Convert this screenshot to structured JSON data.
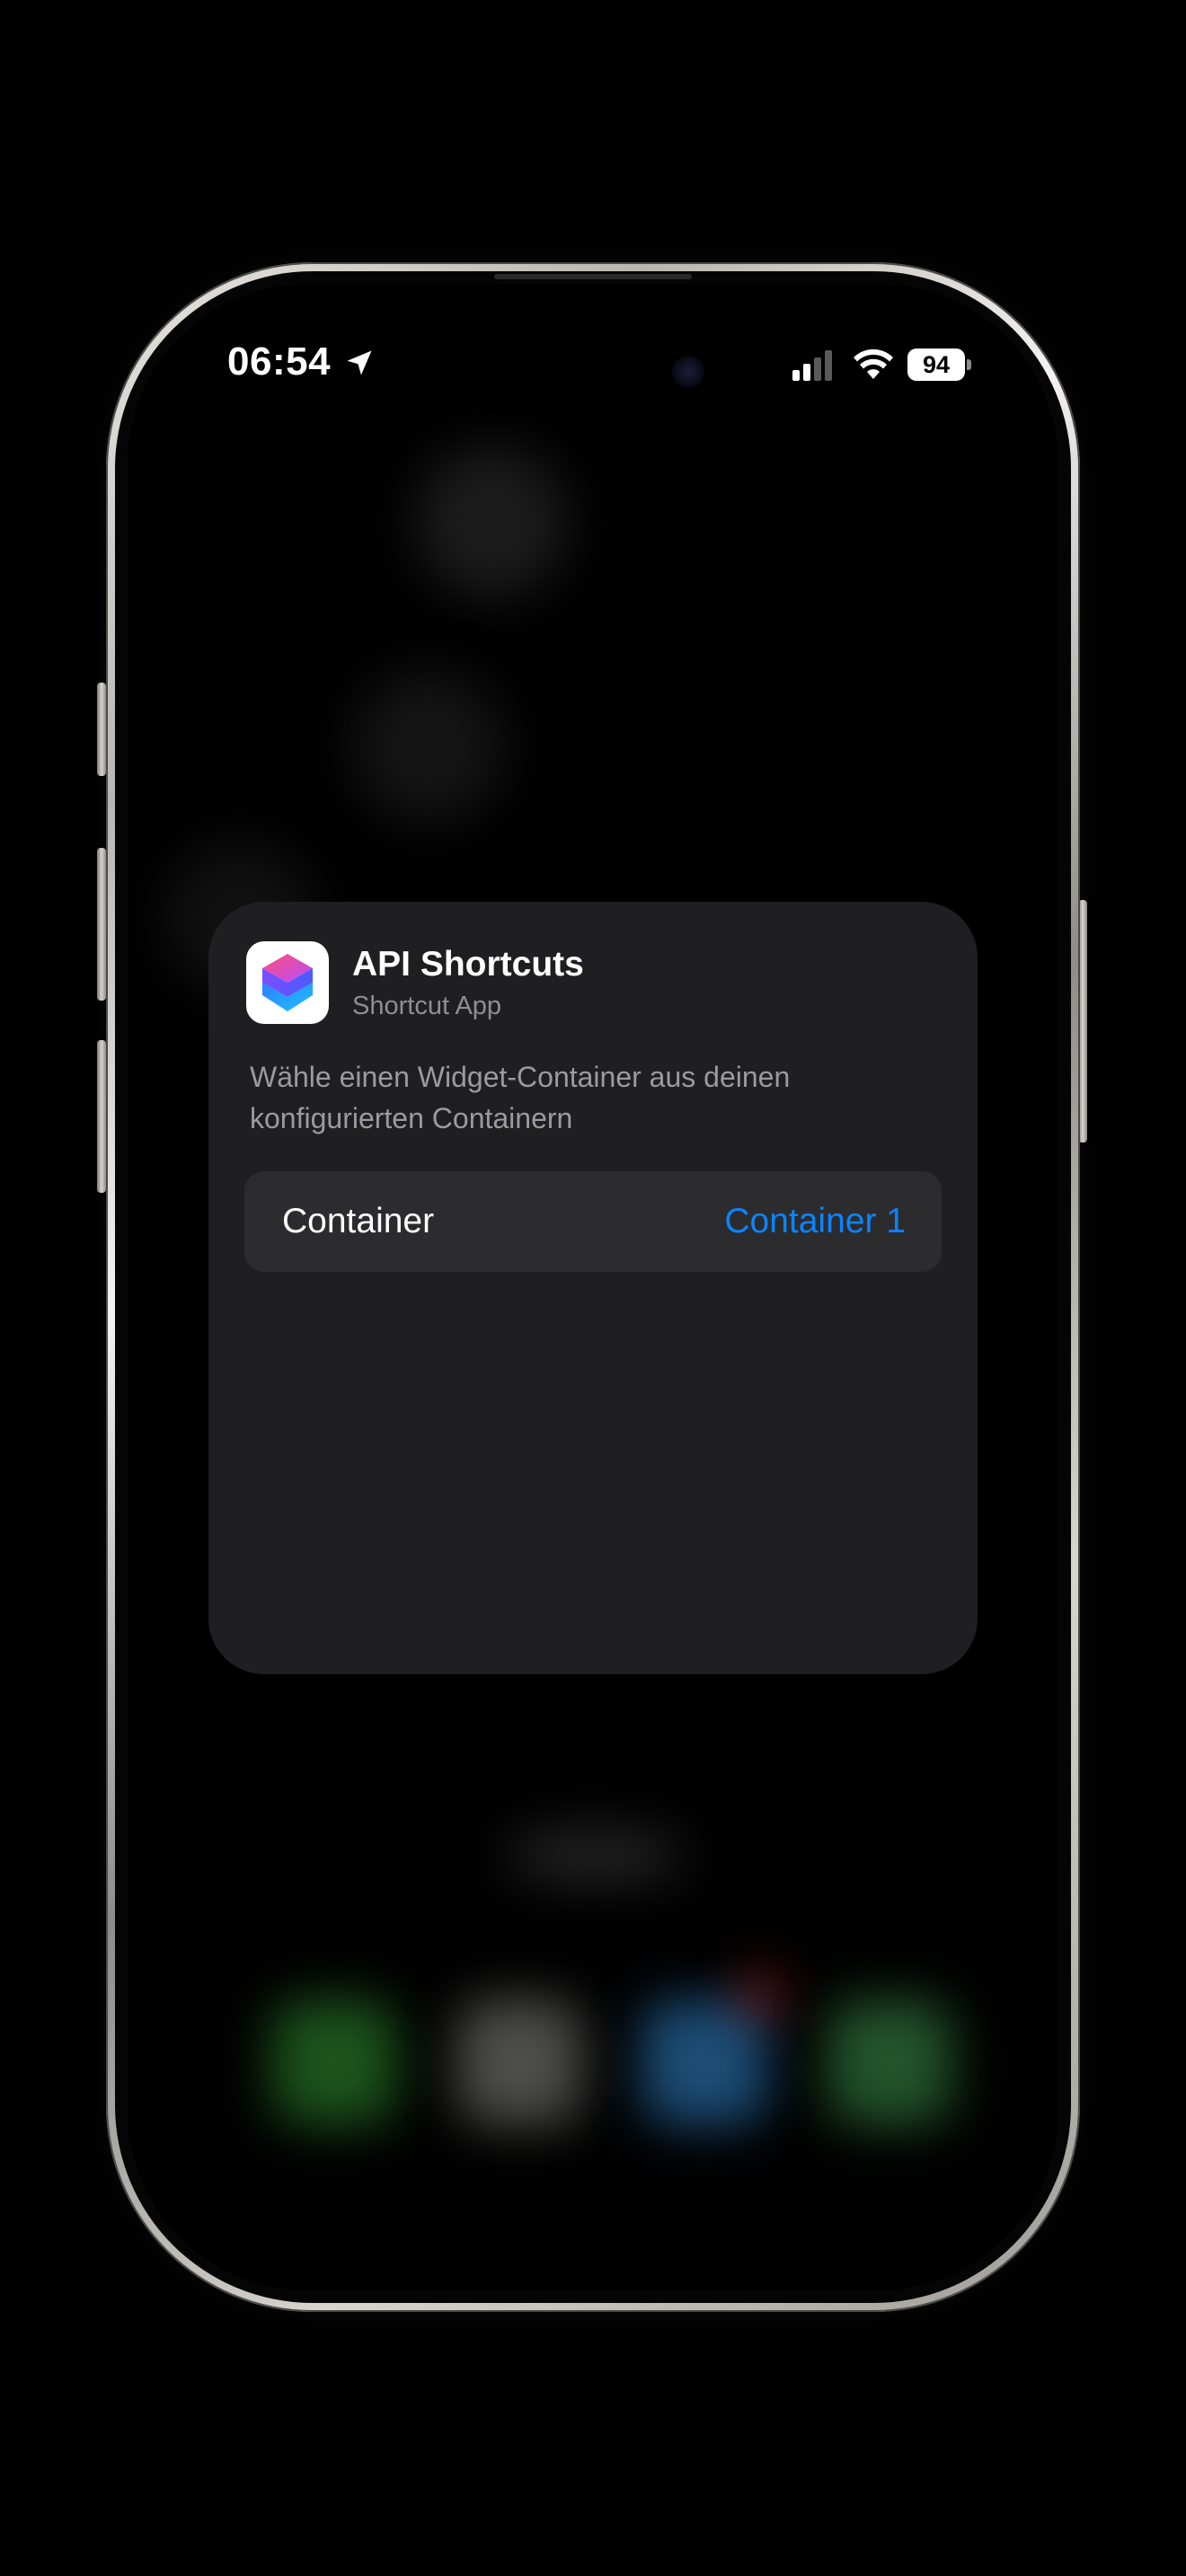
{
  "status_bar": {
    "time": "06:54",
    "battery_level": "94",
    "location_icon": "location-arrow-icon",
    "signal_icon": "cellular-signal-icon",
    "wifi_icon": "wifi-icon"
  },
  "widget_config": {
    "app_name": "API Shortcuts",
    "app_subtitle": "Shortcut App",
    "app_icon": "hexagon-cube-icon",
    "description_line1": "Wähle einen Widget-Container aus deinen",
    "description_line2": "konfigurierten Containern",
    "parameter": {
      "label": "Container",
      "value": "Container 1"
    }
  },
  "colors": {
    "accent": "#0a84ff",
    "card_background": "#1f1f21",
    "row_background": "#2c2c2e",
    "secondary_text": "#8e8e93"
  }
}
